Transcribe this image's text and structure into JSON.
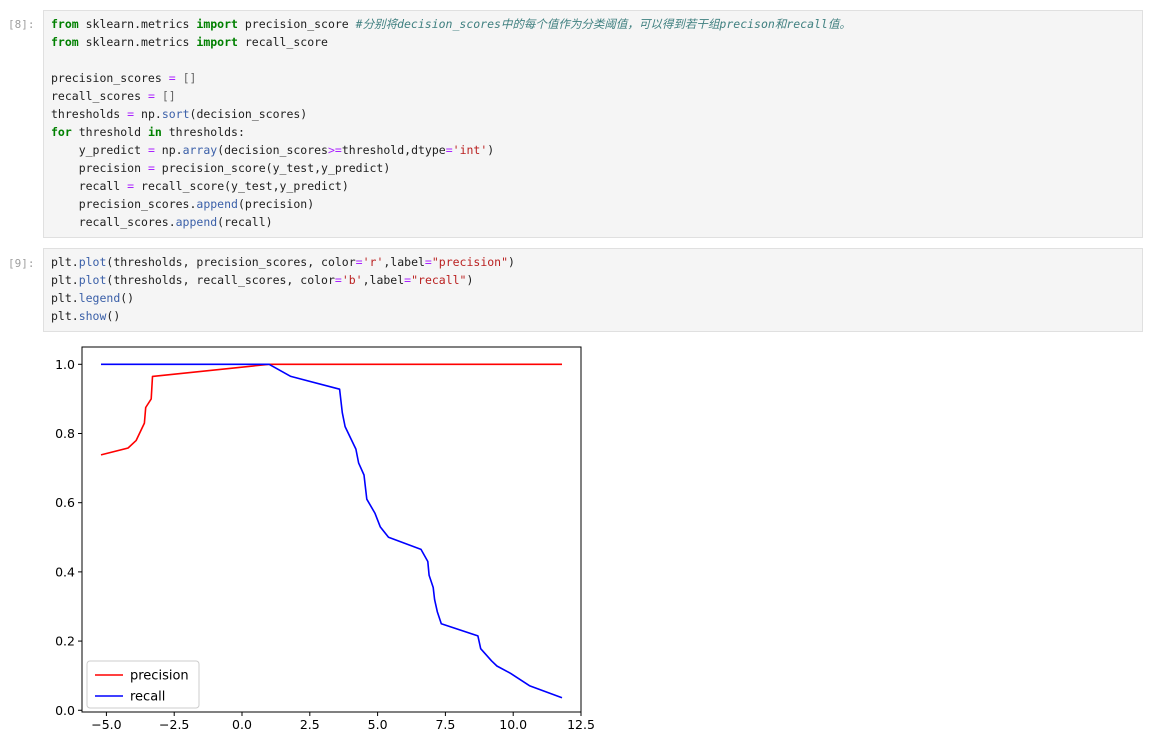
{
  "cells": [
    {
      "prompt": "[8]:",
      "lines": [
        [
          [
            "kw",
            "from"
          ],
          [
            "t",
            " sklearn.metrics "
          ],
          [
            "kw",
            "import"
          ],
          [
            "t",
            " precision_score "
          ],
          [
            "cm",
            "#分别将decision_scores中的每个值作为分类阈值，可以得到若干组precison和recall值。"
          ]
        ],
        [
          [
            "kw",
            "from"
          ],
          [
            "t",
            " sklearn.metrics "
          ],
          [
            "kw",
            "import"
          ],
          [
            "t",
            " recall_score"
          ]
        ],
        [],
        [
          [
            "t",
            "precision_scores "
          ],
          [
            "op",
            "="
          ],
          [
            "t",
            " "
          ],
          [
            "ln",
            "[]"
          ]
        ],
        [
          [
            "t",
            "recall_scores "
          ],
          [
            "op",
            "="
          ],
          [
            "t",
            " "
          ],
          [
            "ln",
            "[]"
          ]
        ],
        [
          [
            "t",
            "thresholds "
          ],
          [
            "op",
            "="
          ],
          [
            "t",
            " np."
          ],
          [
            "fn",
            "sort"
          ],
          [
            "t",
            "(decision_scores)"
          ]
        ],
        [
          [
            "kw",
            "for"
          ],
          [
            "t",
            " threshold "
          ],
          [
            "kw",
            "in"
          ],
          [
            "t",
            " thresholds:"
          ]
        ],
        [
          [
            "t",
            "    y_predict "
          ],
          [
            "op",
            "="
          ],
          [
            "t",
            " np."
          ],
          [
            "fn",
            "array"
          ],
          [
            "t",
            "(decision_scores"
          ],
          [
            "op",
            ">="
          ],
          [
            "t",
            "threshold,dtype"
          ],
          [
            "op",
            "="
          ],
          [
            "str",
            "'int'"
          ],
          [
            "t",
            ")"
          ]
        ],
        [
          [
            "t",
            "    precision "
          ],
          [
            "op",
            "="
          ],
          [
            "t",
            " precision_score(y_test,y_predict)"
          ]
        ],
        [
          [
            "t",
            "    recall "
          ],
          [
            "op",
            "="
          ],
          [
            "t",
            " recall_score(y_test,y_predict)"
          ]
        ],
        [
          [
            "t",
            "    precision_scores."
          ],
          [
            "fn",
            "append"
          ],
          [
            "t",
            "(precision)"
          ]
        ],
        [
          [
            "t",
            "    recall_scores."
          ],
          [
            "fn",
            "append"
          ],
          [
            "t",
            "(recall)"
          ]
        ]
      ]
    },
    {
      "prompt": "[9]:",
      "lines": [
        [
          [
            "t",
            "plt."
          ],
          [
            "fn",
            "plot"
          ],
          [
            "t",
            "(thresholds, precision_scores, color"
          ],
          [
            "op",
            "="
          ],
          [
            "str",
            "'r'"
          ],
          [
            "t",
            ",label"
          ],
          [
            "op",
            "="
          ],
          [
            "str",
            "\"precision\""
          ],
          [
            "t",
            ")"
          ]
        ],
        [
          [
            "t",
            "plt."
          ],
          [
            "fn",
            "plot"
          ],
          [
            "t",
            "(thresholds, recall_scores, color"
          ],
          [
            "op",
            "="
          ],
          [
            "str",
            "'b'"
          ],
          [
            "t",
            ",label"
          ],
          [
            "op",
            "="
          ],
          [
            "str",
            "\"recall\""
          ],
          [
            "t",
            ")"
          ]
        ],
        [
          [
            "t",
            "plt."
          ],
          [
            "fn",
            "legend"
          ],
          [
            "t",
            "()"
          ]
        ],
        [
          [
            "t",
            "plt."
          ],
          [
            "fn",
            "show"
          ],
          [
            "t",
            "()"
          ]
        ]
      ]
    }
  ],
  "chart_data": {
    "type": "line",
    "title": "",
    "xlabel": "",
    "ylabel": "",
    "xlim": [
      -5.9,
      12.5
    ],
    "ylim": [
      -0.005,
      1.05
    ],
    "xticks": [
      -5.0,
      -2.5,
      0.0,
      2.5,
      5.0,
      7.5,
      10.0,
      12.5
    ],
    "xtick_labels": [
      "−5.0",
      "−2.5",
      "0.0",
      "2.5",
      "5.0",
      "7.5",
      "10.0",
      "12.5"
    ],
    "yticks": [
      0.0,
      0.2,
      0.4,
      0.6,
      0.8,
      1.0
    ],
    "ytick_labels": [
      "0.0",
      "0.2",
      "0.4",
      "0.6",
      "0.8",
      "1.0"
    ],
    "grid": false,
    "legend_position": "lower-left",
    "series": [
      {
        "name": "precision",
        "color": "#ff0000",
        "x": [
          -5.2,
          -4.2,
          -3.9,
          -3.6,
          -3.55,
          -3.35,
          -3.3,
          1.0,
          1.1,
          11.8
        ],
        "y": [
          0.738,
          0.758,
          0.78,
          0.83,
          0.875,
          0.9,
          0.965,
          1.0,
          1.0,
          1.0
        ]
      },
      {
        "name": "recall",
        "color": "#0000ff",
        "x": [
          -5.2,
          1.0,
          1.8,
          3.6,
          3.7,
          3.8,
          4.2,
          4.3,
          4.5,
          4.6,
          4.9,
          5.1,
          5.4,
          6.6,
          6.85,
          6.9,
          7.05,
          7.1,
          7.2,
          7.35,
          8.7,
          8.8,
          9.2,
          9.4,
          9.9,
          10.6,
          11.8
        ],
        "y": [
          1.0,
          1.0,
          0.965,
          0.928,
          0.86,
          0.82,
          0.755,
          0.715,
          0.68,
          0.61,
          0.57,
          0.53,
          0.5,
          0.465,
          0.43,
          0.39,
          0.355,
          0.32,
          0.285,
          0.25,
          0.215,
          0.178,
          0.143,
          0.128,
          0.107,
          0.071,
          0.036
        ]
      }
    ]
  }
}
